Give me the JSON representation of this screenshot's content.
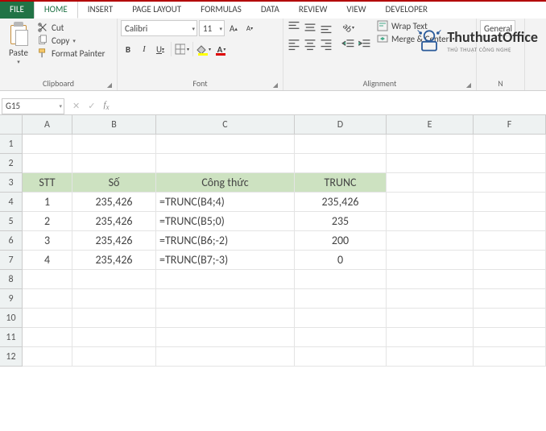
{
  "tabs": {
    "file": "FILE",
    "home": "HOME",
    "insert": "INSERT",
    "page_layout": "PAGE LAYOUT",
    "formulas": "FORMULAS",
    "data": "DATA",
    "review": "REVIEW",
    "view": "VIEW",
    "developer": "DEVELOPER"
  },
  "ribbon": {
    "clipboard": {
      "paste": "Paste",
      "cut": "Cut",
      "copy": "Copy",
      "format_painter": "Format Painter",
      "group_label": "Clipboard"
    },
    "font": {
      "font_name": "Calibri",
      "font_size": "11",
      "group_label": "Font"
    },
    "alignment": {
      "wrap_text": "Wrap Text",
      "merge_center": "Merge & Center",
      "group_label": "Alignment"
    },
    "number": {
      "format": "General",
      "group_label": "N"
    }
  },
  "namebox": "G15",
  "formula": "",
  "columns": [
    "A",
    "B",
    "C",
    "D",
    "E",
    "F"
  ],
  "row_numbers": [
    "1",
    "2",
    "3",
    "4",
    "5",
    "6",
    "7",
    "8",
    "9",
    "10",
    "11",
    "12"
  ],
  "headers": {
    "stt": "STT",
    "so": "Số",
    "congthuc": "Công thức",
    "trunc": "TRUNC"
  },
  "rows": [
    {
      "stt": "1",
      "so": "235,426",
      "congthuc": "=TRUNC(B4;4)",
      "trunc": "235,426"
    },
    {
      "stt": "2",
      "so": "235,426",
      "congthuc": "=TRUNC(B5;0)",
      "trunc": "235"
    },
    {
      "stt": "3",
      "so": "235,426",
      "congthuc": "=TRUNC(B6;-2)",
      "trunc": "200"
    },
    {
      "stt": "4",
      "so": "235,426",
      "congthuc": "=TRUNC(B7;-3)",
      "trunc": "0"
    }
  ],
  "watermark": {
    "title": "ThuthuatOffice",
    "subtitle": "THỦ THUẬT CÔNG NGHỆ"
  }
}
